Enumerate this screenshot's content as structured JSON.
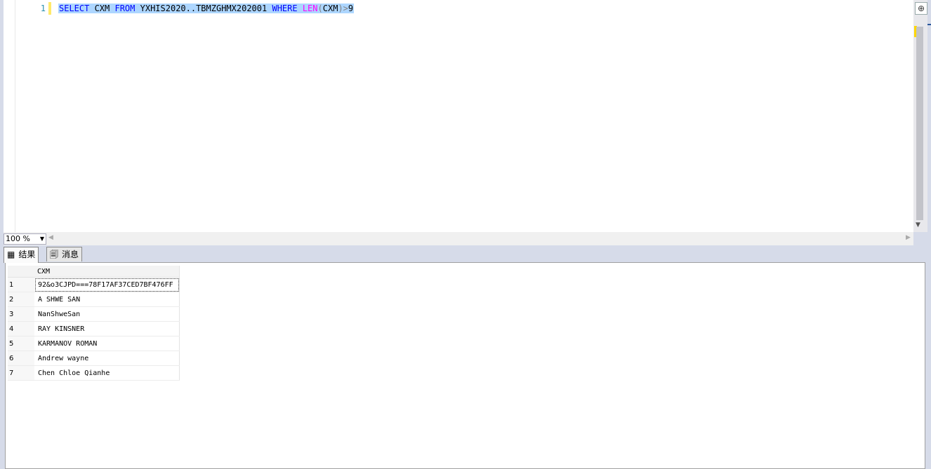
{
  "editor": {
    "line_number": "1",
    "code_tokens": [
      {
        "text": "SELECT",
        "cls": "kw"
      },
      {
        "text": " CXM ",
        "cls": "plain"
      },
      {
        "text": "FROM",
        "cls": "kw"
      },
      {
        "text": " YXHIS2020..TBMZGHMX202001 ",
        "cls": "plain"
      },
      {
        "text": "WHERE",
        "cls": "kw"
      },
      {
        "text": " ",
        "cls": "plain"
      },
      {
        "text": "LEN",
        "cls": "fn"
      },
      {
        "text": "(",
        "cls": "gr"
      },
      {
        "text": "CXM",
        "cls": "plain"
      },
      {
        "text": ")>",
        "cls": "gr"
      },
      {
        "text": "9",
        "cls": "plain"
      }
    ]
  },
  "zoom": {
    "value": "100 %"
  },
  "tabs": [
    {
      "label": "结果",
      "icon": "grid-icon"
    },
    {
      "label": "消息",
      "icon": "message-icon"
    }
  ],
  "results": {
    "column": "CXM",
    "rows": [
      {
        "n": "1",
        "value": "92&o3CJPD===78F17AF37CED7BF476FF"
      },
      {
        "n": "2",
        "value": "A SHWE SAN"
      },
      {
        "n": "3",
        "value": "NanShweSan"
      },
      {
        "n": "4",
        "value": "RAY KINSNER"
      },
      {
        "n": "5",
        "value": "KARMANOV ROMAN"
      },
      {
        "n": "6",
        "value": "Andrew wayne"
      },
      {
        "n": "7",
        "value": "Chen Chloe Qianhe"
      }
    ]
  },
  "colors": {
    "keyword": "#0000ff",
    "function": "#ff00ff",
    "selection": "#add6ff",
    "line_number": "#2b91af"
  }
}
